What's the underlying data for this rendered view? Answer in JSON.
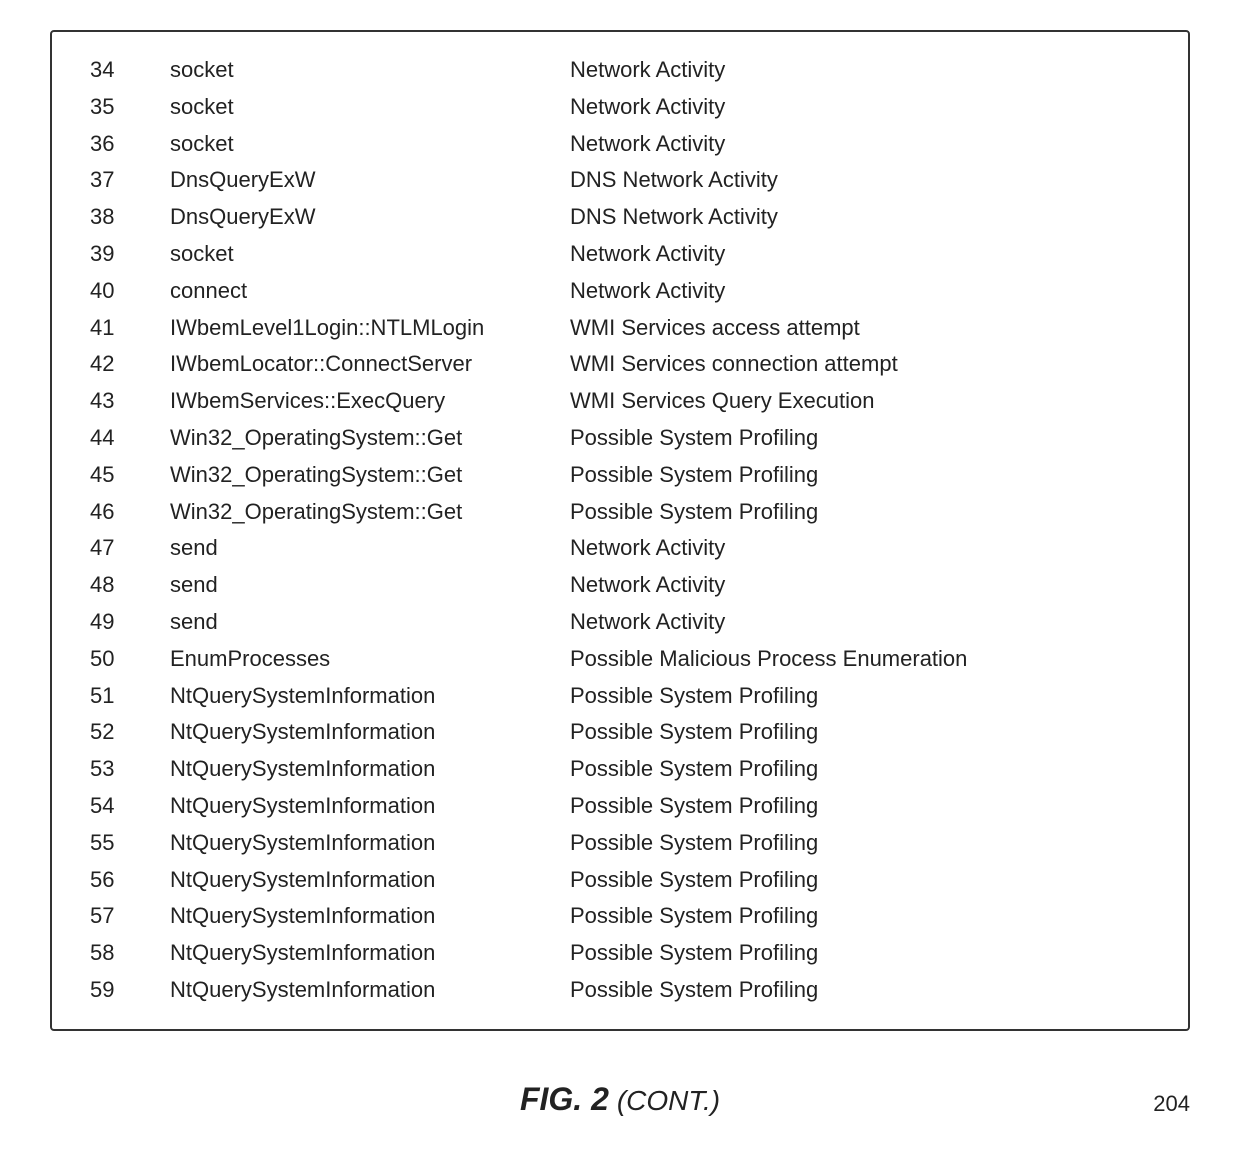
{
  "table": {
    "rows": [
      {
        "num": "34",
        "call": "socket",
        "desc": "Network Activity"
      },
      {
        "num": "35",
        "call": "socket",
        "desc": "Network Activity"
      },
      {
        "num": "36",
        "call": "socket",
        "desc": "Network Activity"
      },
      {
        "num": "37",
        "call": "DnsQueryExW",
        "desc": "DNS Network Activity"
      },
      {
        "num": "38",
        "call": "DnsQueryExW",
        "desc": "DNS Network Activity"
      },
      {
        "num": "39",
        "call": "socket",
        "desc": "Network Activity"
      },
      {
        "num": "40",
        "call": "connect",
        "desc": "Network Activity"
      },
      {
        "num": "41",
        "call": "IWbemLevel1Login::NTLMLogin",
        "desc": "WMI Services access attempt"
      },
      {
        "num": "42",
        "call": "IWbemLocator::ConnectServer",
        "desc": "WMI Services connection attempt"
      },
      {
        "num": "43",
        "call": "IWbemServices::ExecQuery",
        "desc": "WMI Services Query Execution"
      },
      {
        "num": "44",
        "call": "Win32_OperatingSystem::Get",
        "desc": "Possible System Profiling"
      },
      {
        "num": "45",
        "call": "Win32_OperatingSystem::Get",
        "desc": "Possible System Profiling"
      },
      {
        "num": "46",
        "call": "Win32_OperatingSystem::Get",
        "desc": "Possible System Profiling"
      },
      {
        "num": "47",
        "call": "send",
        "desc": "Network Activity"
      },
      {
        "num": "48",
        "call": "send",
        "desc": "Network Activity"
      },
      {
        "num": "49",
        "call": "send",
        "desc": "Network Activity"
      },
      {
        "num": "50",
        "call": "EnumProcesses",
        "desc": "Possible Malicious Process Enumeration"
      },
      {
        "num": "51",
        "call": "NtQuerySystemInformation",
        "desc": "Possible System Profiling"
      },
      {
        "num": "52",
        "call": "NtQuerySystemInformation",
        "desc": "Possible System Profiling"
      },
      {
        "num": "53",
        "call": "NtQuerySystemInformation",
        "desc": "Possible System Profiling"
      },
      {
        "num": "54",
        "call": "NtQuerySystemInformation",
        "desc": "Possible System Profiling"
      },
      {
        "num": "55",
        "call": "NtQuerySystemInformation",
        "desc": "Possible System Profiling"
      },
      {
        "num": "56",
        "call": "NtQuerySystemInformation",
        "desc": "Possible System Profiling"
      },
      {
        "num": "57",
        "call": "NtQuerySystemInformation",
        "desc": "Possible System Profiling"
      },
      {
        "num": "58",
        "call": "NtQuerySystemInformation",
        "desc": "Possible System Profiling"
      },
      {
        "num": "59",
        "call": "NtQuerySystemInformation",
        "desc": "Possible System Profiling"
      }
    ]
  },
  "figure": {
    "label": "FIG. 2",
    "cont": "(CONT.)",
    "page_number": "204"
  }
}
